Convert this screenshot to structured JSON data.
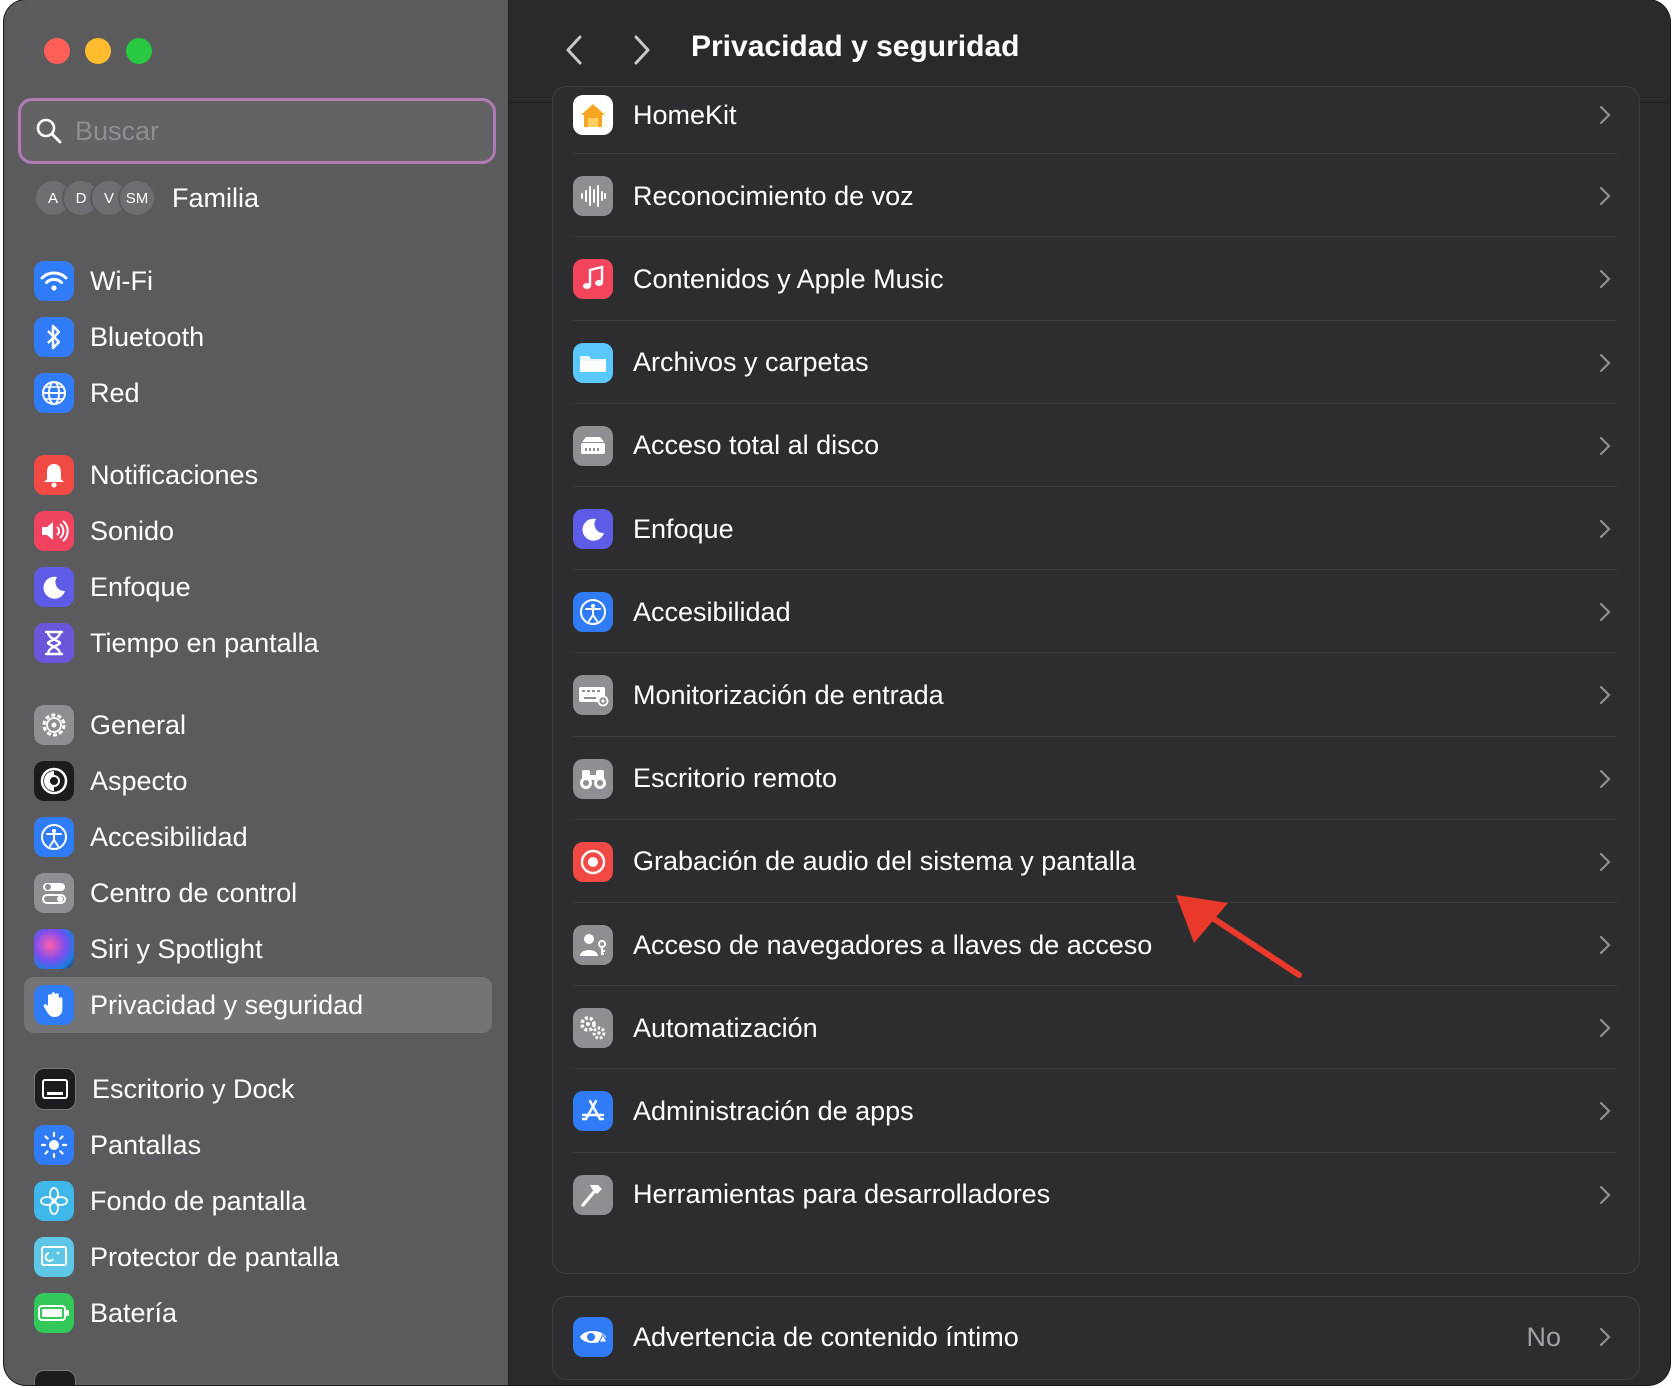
{
  "window": {
    "title": "Privacidad y seguridad"
  },
  "sidebar": {
    "search_placeholder": "Buscar",
    "family": {
      "label": "Familia",
      "avatars": [
        "A",
        "D",
        "V",
        "SM"
      ]
    },
    "items": [
      {
        "label": "Wi-Fi",
        "icon": "wifi-icon",
        "color": "#2f7cf6"
      },
      {
        "label": "Bluetooth",
        "icon": "bluetooth-icon",
        "color": "#2f7cf6"
      },
      {
        "label": "Red",
        "icon": "globe-icon",
        "color": "#2f7cf6"
      },
      {
        "label": "Notificaciones",
        "icon": "bell-icon",
        "color": "#f14a45"
      },
      {
        "label": "Sonido",
        "icon": "speaker-icon",
        "color": "#f0435f"
      },
      {
        "label": "Enfoque",
        "icon": "moon-icon",
        "color": "#5e5ce6"
      },
      {
        "label": "Tiempo en pantalla",
        "icon": "hourglass-icon",
        "color": "#6a56d9"
      },
      {
        "label": "General",
        "icon": "gear-icon",
        "color": "#8e8e93"
      },
      {
        "label": "Aspecto",
        "icon": "appearance-icon",
        "color": "#1c1c1e"
      },
      {
        "label": "Accesibilidad",
        "icon": "accessibility-icon",
        "color": "#2f7cf6"
      },
      {
        "label": "Centro de control",
        "icon": "control-center-icon",
        "color": "#8e8e93"
      },
      {
        "label": "Siri y Spotlight",
        "icon": "siri-icon",
        "color": "#3b2a70"
      },
      {
        "label": "Privacidad y seguridad",
        "icon": "hand-icon",
        "color": "#2f7cf6",
        "selected": true
      },
      {
        "label": "Escritorio y Dock",
        "icon": "dock-icon",
        "color": "#1c1c1e"
      },
      {
        "label": "Pantallas",
        "icon": "sun-icon",
        "color": "#2f7cf6"
      },
      {
        "label": "Fondo de pantalla",
        "icon": "flower-icon",
        "color": "#3fb7e8"
      },
      {
        "label": "Protector de pantalla",
        "icon": "screensaver-icon",
        "color": "#5fc7e6"
      },
      {
        "label": "Batería",
        "icon": "battery-icon",
        "color": "#34c759"
      }
    ]
  },
  "main": {
    "rows": [
      {
        "label": "HomeKit",
        "icon": "home-icon",
        "color": "#ffffff"
      },
      {
        "label": "Reconocimiento de voz",
        "icon": "waveform-icon",
        "color": "#8e8e93"
      },
      {
        "label": "Contenidos y Apple Music",
        "icon": "music-note-icon",
        "color": "#f2455b"
      },
      {
        "label": "Archivos y carpetas",
        "icon": "folder-icon",
        "color": "#5ac8fa"
      },
      {
        "label": "Acceso total al disco",
        "icon": "disk-icon",
        "color": "#8e8e93"
      },
      {
        "label": "Enfoque",
        "icon": "moon-icon",
        "color": "#5e5ce6"
      },
      {
        "label": "Accesibilidad",
        "icon": "accessibility-icon",
        "color": "#2f7cf6"
      },
      {
        "label": "Monitorización de entrada",
        "icon": "keyboard-icon",
        "color": "#8e8e93"
      },
      {
        "label": "Escritorio remoto",
        "icon": "binoculars-icon",
        "color": "#8e8e93"
      },
      {
        "label": "Grabación de audio del sistema y pantalla",
        "icon": "record-icon",
        "color": "#f14a45"
      },
      {
        "label": "Acceso de navegadores a llaves de acceso",
        "icon": "person-key-icon",
        "color": "#8e8e93"
      },
      {
        "label": "Automatización",
        "icon": "gears-icon",
        "color": "#8e8e93"
      },
      {
        "label": "Administración de apps",
        "icon": "app-store-icon",
        "color": "#2f7cf6"
      },
      {
        "label": "Herramientas para desarrolladores",
        "icon": "hammer-icon",
        "color": "#8e8e93"
      }
    ],
    "bottom_row": {
      "label": "Advertencia de contenido íntimo",
      "value": "No",
      "icon": "eye-warning-icon",
      "color": "#2f7cf6"
    }
  },
  "annotation": {
    "color": "#e8392a"
  }
}
